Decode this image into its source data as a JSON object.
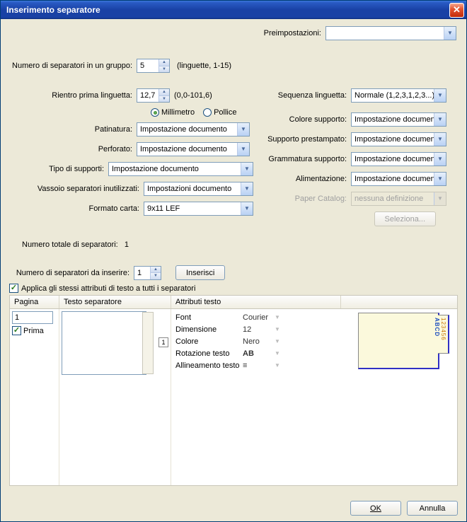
{
  "title": "Inserimento separatore",
  "presets_label": "Preimpostazioni:",
  "left": {
    "numGroup_label": "Numero di separatori in un gruppo:",
    "numGroup_value": "5",
    "numGroup_hint": "(linguette, 1-15)",
    "rientro_label": "Rientro prima linguetta:",
    "rientro_value": "12,7",
    "rientro_hint": "(0,0-101,6)",
    "unit_mm": "Millimetro",
    "unit_in": "Pollice",
    "patinatura_label": "Patinatura:",
    "patinatura_value": "Impostazione documento",
    "perforato_label": "Perforato:",
    "perforato_value": "Impostazione documento",
    "tipo_label": "Tipo di supporti:",
    "tipo_value": "Impostazione documento",
    "vassoio_label": "Vassoio separatori inutilizzati:",
    "vassoio_value": "Impostazioni documento",
    "formato_label": "Formato carta:",
    "formato_value": "9x11 LEF"
  },
  "right": {
    "sequenza_label": "Sequenza linguetta:",
    "sequenza_value": "Normale (1,2,3,1,2,3...)",
    "colore_label": "Colore supporto:",
    "colore_value": "Impostazione documento",
    "prestampato_label": "Supporto prestampato:",
    "prestampato_value": "Impostazione documento",
    "grammatura_label": "Grammatura supporto:",
    "grammatura_value": "Impostazione documento",
    "alimentazione_label": "Alimentazione:",
    "alimentazione_value": "Impostazione documento",
    "catalog_label": "Paper Catalog:",
    "catalog_value": "nessuna definizione",
    "seleziona_btn": "Seleziona..."
  },
  "totals": {
    "totale_label": "Numero totale di separatori:",
    "totale_value": "1",
    "inserire_label": "Numero di separatori da inserire:",
    "inserire_value": "1",
    "inserisci_btn": "Inserisci",
    "apply_label": "Applica gli stessi attributi di testo a tutti i separatori"
  },
  "table": {
    "col_pagina": "Pagina",
    "col_testo": "Testo separatore",
    "col_attr": "Attributi testo",
    "pagina_value": "1",
    "prima_label": "Prima",
    "marker": "1",
    "attrs": {
      "font_l": "Font",
      "font_v": "Courier",
      "dim_l": "Dimensione",
      "dim_v": "12",
      "col_l": "Colore",
      "col_v": "Nero",
      "rot_l": "Rotazione testo",
      "rot_v": "AB",
      "alin_l": "Allineamento testo"
    },
    "preview_abcd": "ABCD",
    "preview_nums": "123456"
  },
  "footer": {
    "ok": "OK",
    "cancel": "Annulla"
  }
}
